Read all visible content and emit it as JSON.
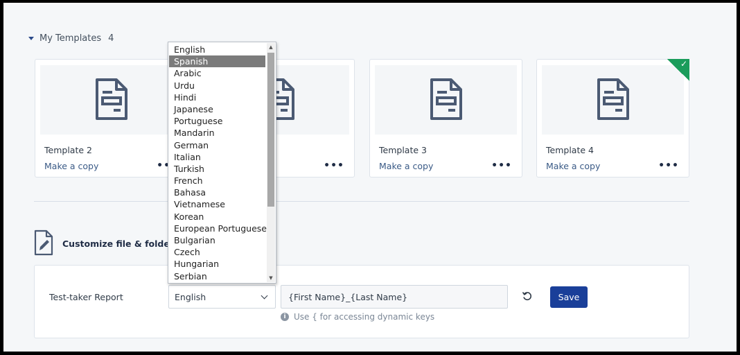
{
  "section": {
    "title": "My Templates",
    "count": "4"
  },
  "cards": [
    {
      "title": "Template 2",
      "action": "Make a copy",
      "more": "•••",
      "selected": false
    },
    {
      "title": "",
      "action": "",
      "more": "•••",
      "selected": false
    },
    {
      "title": "Template 3",
      "action": "Make a copy",
      "more": "•••",
      "selected": false
    },
    {
      "title": "Template 4",
      "action": "Make a copy",
      "more": "•••",
      "selected": true
    }
  ],
  "customize": {
    "label": "Customize file & folder nar"
  },
  "report": {
    "label": "Test-taker Report",
    "language": "English",
    "name_value": "{First Name}_{Last Name}",
    "save_label": "Save",
    "hint": "Use { for accessing dynamic keys"
  },
  "dropdown": {
    "selected": "Spanish",
    "options": [
      "English",
      "Spanish",
      "Arabic",
      "Urdu",
      "Hindi",
      "Japanese",
      "Portuguese",
      "Mandarin",
      "German",
      "Italian",
      "Turkish",
      "French",
      "Bahasa",
      "Vietnamese",
      "Korean",
      "European Portuguese",
      "Bulgarian",
      "Czech",
      "Hungarian",
      "Serbian"
    ]
  },
  "icons": {
    "template": "document-icon",
    "check": "check-icon",
    "edit": "edit-document-icon",
    "reset": "reset-icon",
    "info": "info-icon"
  },
  "colors": {
    "accent": "#1a3f99",
    "selected_corner": "#1a9c5b",
    "link": "#3a5a86"
  }
}
